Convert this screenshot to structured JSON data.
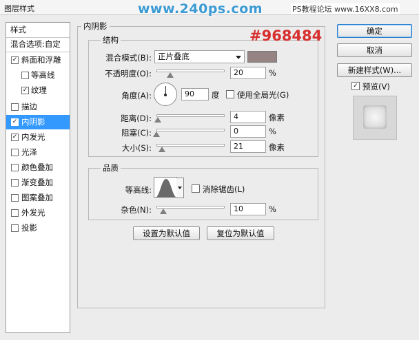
{
  "window": {
    "title": "图层样式"
  },
  "watermark": {
    "url": "www.240ps.com",
    "site": "PS教程论坛 www.16XX8.com"
  },
  "annotation": {
    "hex_color": "#968484"
  },
  "style_list": {
    "items": [
      {
        "label": "样式",
        "type": "header",
        "checked": false,
        "selected": false
      },
      {
        "label": "混合选项:自定",
        "type": "header",
        "checked": false,
        "selected": false
      },
      {
        "label": "斜面和浮雕",
        "type": "item",
        "checked": true,
        "selected": false
      },
      {
        "label": "等高线",
        "type": "sub",
        "checked": false,
        "selected": false
      },
      {
        "label": "纹理",
        "type": "sub",
        "checked": true,
        "selected": false
      },
      {
        "label": "描边",
        "type": "item",
        "checked": false,
        "selected": false
      },
      {
        "label": "内阴影",
        "type": "item",
        "checked": true,
        "selected": true
      },
      {
        "label": "内发光",
        "type": "item",
        "checked": true,
        "selected": false
      },
      {
        "label": "光泽",
        "type": "item",
        "checked": false,
        "selected": false
      },
      {
        "label": "颜色叠加",
        "type": "item",
        "checked": false,
        "selected": false
      },
      {
        "label": "渐变叠加",
        "type": "item",
        "checked": false,
        "selected": false
      },
      {
        "label": "图案叠加",
        "type": "item",
        "checked": false,
        "selected": false
      },
      {
        "label": "外发光",
        "type": "item",
        "checked": false,
        "selected": false
      },
      {
        "label": "投影",
        "type": "item",
        "checked": false,
        "selected": false
      }
    ]
  },
  "inner_shadow": {
    "title": "内阴影",
    "structure": {
      "title": "结构",
      "blend_mode_label": "混合模式(B):",
      "blend_mode_value": "正片叠底",
      "color": "#968484",
      "opacity_label": "不透明度(O):",
      "opacity_value": "20",
      "opacity_unit": "%",
      "opacity_fraction": 0.2,
      "angle_label": "角度(A):",
      "angle_value": "90",
      "angle_unit": "度",
      "global_light_label": "使用全局光(G)",
      "global_light_checked": false,
      "distance_label": "距离(D):",
      "distance_value": "4",
      "distance_unit": "像素",
      "distance_fraction": 0.02,
      "choke_label": "阻塞(C):",
      "choke_value": "0",
      "choke_unit": "%",
      "choke_fraction": 0.0,
      "size_label": "大小(S):",
      "size_value": "21",
      "size_unit": "像素",
      "size_fraction": 0.08
    },
    "quality": {
      "title": "品质",
      "contour_label": "等高线:",
      "antialias_label": "消除锯齿(L)",
      "antialias_checked": false,
      "noise_label": "杂色(N):",
      "noise_value": "10",
      "noise_unit": "%",
      "noise_fraction": 0.1
    },
    "make_default_label": "设置为默认值",
    "reset_default_label": "复位为默认值"
  },
  "buttons": {
    "ok": "确定",
    "cancel": "取消",
    "new_style": "新建样式(W)...",
    "preview_label": "预览(V)",
    "preview_checked": true
  }
}
